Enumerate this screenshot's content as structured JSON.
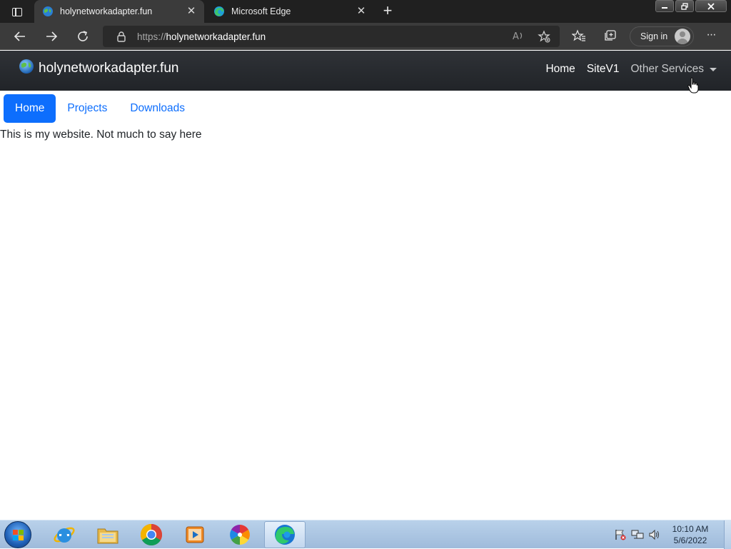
{
  "browser": {
    "tabs": [
      {
        "title": "holynetworkadapter.fun",
        "active": true,
        "favicon": "globe-icon"
      },
      {
        "title": "Microsoft Edge",
        "active": false,
        "favicon": "edge-icon"
      }
    ],
    "close_glyph": "✕",
    "new_tab_glyph": "+",
    "address": {
      "scheme": "https://",
      "host": "holynetworkadapter.fun"
    },
    "signin_label": "Sign in",
    "more_glyph": "···"
  },
  "site": {
    "brand": "holynetworkadapter.fun",
    "nav": [
      {
        "label": "Home"
      },
      {
        "label": "SiteV1"
      },
      {
        "label": "Other Services",
        "dropdown": true
      }
    ],
    "pills": [
      {
        "label": "Home",
        "active": true
      },
      {
        "label": "Projects",
        "active": false
      },
      {
        "label": "Downloads",
        "active": false
      }
    ],
    "body_text": "This is my website. Not much to say here"
  },
  "taskbar": {
    "apps": [
      "internet-explorer-icon",
      "file-explorer-icon",
      "chrome-icon",
      "media-player-icon",
      "photos-icon",
      "edge-icon"
    ],
    "active_app": "edge-icon",
    "clock": {
      "time": "10:10 AM",
      "date": "5/6/2022"
    }
  },
  "colors": {
    "primary": "#0d6efd",
    "navbar": "#212428",
    "browser_chrome": "#202020",
    "taskbar": "#b9d1ea"
  }
}
